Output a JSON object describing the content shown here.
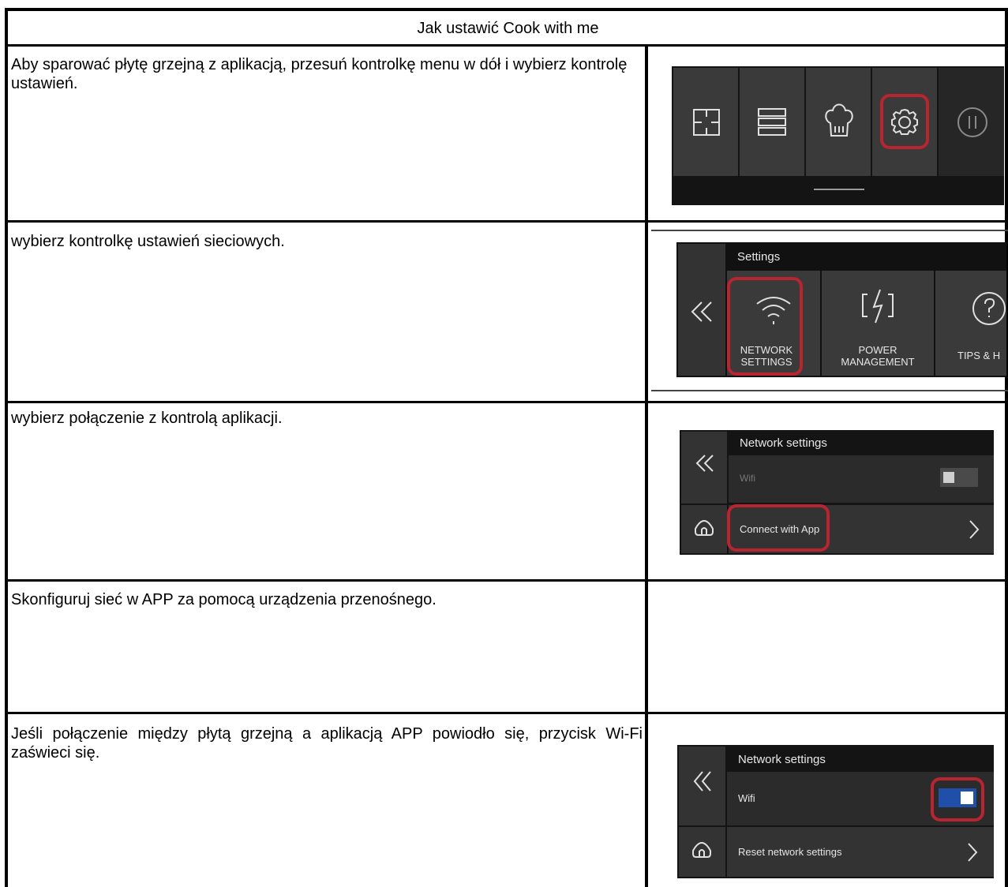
{
  "document": {
    "title": "Jak ustawić Cook with me",
    "steps": [
      {
        "text": "Aby sparować płytę grzejną z aplikacją, przesuń kontrolkę menu w dół i wybierz kontrolę ustawień."
      },
      {
        "text": "wybierz kontrolkę ustawień sieciowych."
      },
      {
        "text": "wybierz połączenie z kontrolą aplikacji."
      },
      {
        "text": "Skonfiguruj sieć w APP za pomocą urządzenia przenośnego."
      },
      {
        "text": "Jeśli połączenie między płytą grzejną a aplikacją APP powiodło się, przycisk Wi-Fi zaświeci się."
      }
    ]
  },
  "screen1": {
    "icons": [
      "zones-icon",
      "menu-icon",
      "chef-hat-icon",
      "settings-gear-icon",
      "pause-icon"
    ],
    "highlighted": "settings-gear-icon"
  },
  "screen2": {
    "header": "Settings",
    "tiles": [
      {
        "label_line1": "NETWORK",
        "label_line2": "SETTINGS",
        "icon": "wifi-icon"
      },
      {
        "label_line1": "POWER",
        "label_line2": "MANAGEMENT",
        "icon": "power-icon"
      },
      {
        "label_line1": "TIPS & H",
        "label_line2": "",
        "icon": "help-icon"
      }
    ]
  },
  "screen3": {
    "header": "Network settings",
    "wifi_label": "Wifi",
    "wifi_on": false,
    "connect_label": "Connect with App"
  },
  "screen5": {
    "header": "Network settings",
    "wifi_label": "Wifi",
    "wifi_on": true,
    "reset_label": "Reset network settings"
  },
  "colors": {
    "highlight": "#b8242f",
    "toggle_on": "#1f4fa8",
    "panel_bg": "#1e1e1e"
  }
}
